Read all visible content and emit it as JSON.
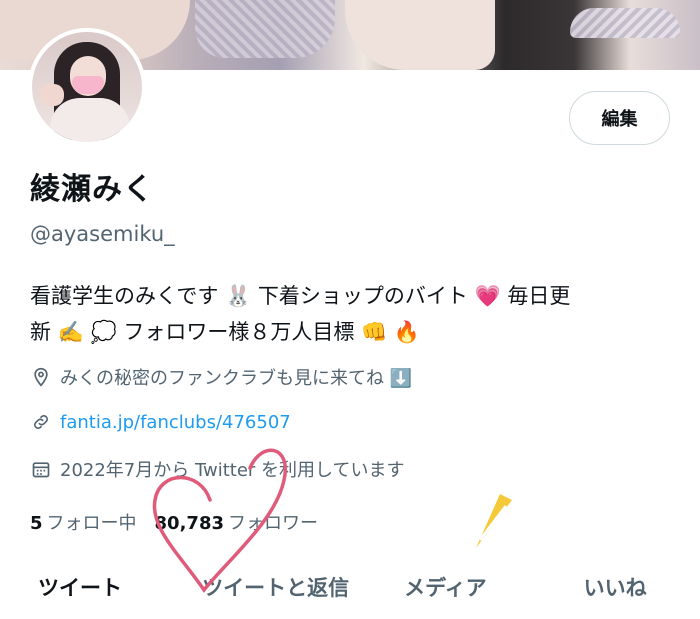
{
  "profile": {
    "name": "綾瀬みく",
    "handle": "@ayasemiku_",
    "bio_line1": "看護学生のみくです 🐰 下着ショップのバイト 💗 毎日更",
    "bio_line2": "新 ✍️ 💭 フォロワー様８万人目標 👊 🔥",
    "location": "みくの秘密のファンクラブも見に来てね ⬇️",
    "website": "fantia.jp/fanclubs/476507",
    "joined": "2022年7月から Twitter を利用しています",
    "edit_label": "編集"
  },
  "stats": {
    "following_count": "5",
    "following_label": "フォロー中",
    "followers_count": "80,783",
    "followers_label": "フォロワー"
  },
  "tabs": [
    {
      "label": "ツイート",
      "active": true
    },
    {
      "label": "ツイートと返信",
      "active": false
    },
    {
      "label": "メディア",
      "active": false
    },
    {
      "label": "いいね",
      "active": false
    }
  ],
  "icons": {
    "location": "location-pin-icon",
    "link": "link-icon",
    "calendar": "calendar-icon"
  },
  "colors": {
    "accent_link": "#1d9bf0",
    "muted_text": "#536471",
    "heart_doodle": "#e05a7a"
  }
}
